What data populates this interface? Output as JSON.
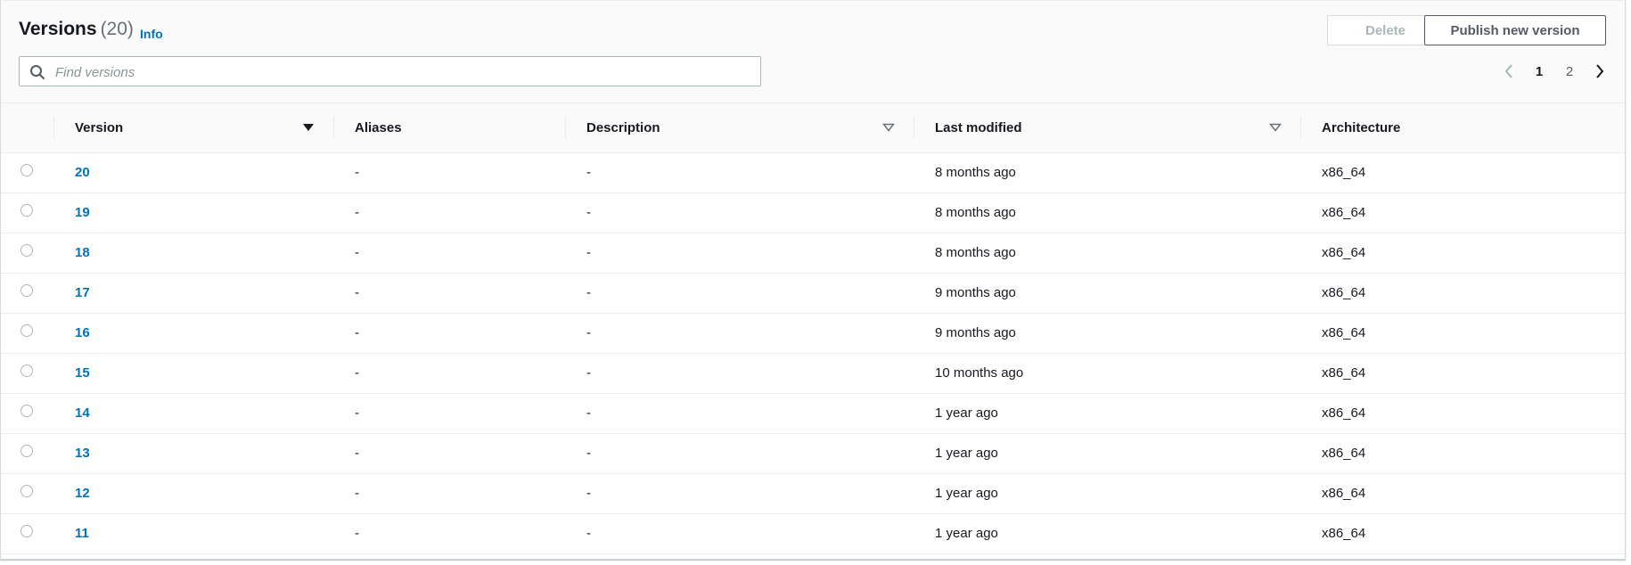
{
  "header": {
    "title": "Versions",
    "count": "(20)",
    "info_label": "Info",
    "delete_label": "Delete",
    "publish_label": "Publish new version"
  },
  "search": {
    "placeholder": "Find versions",
    "value": ""
  },
  "pagination": {
    "pages": [
      "1",
      "2"
    ],
    "current_page": "1"
  },
  "table": {
    "columns": [
      "Version",
      "Aliases",
      "Description",
      "Last modified",
      "Architecture"
    ],
    "rows": [
      {
        "version": "20",
        "aliases": "-",
        "description": "-",
        "last_modified": "8 months ago",
        "architecture": "x86_64"
      },
      {
        "version": "19",
        "aliases": "-",
        "description": "-",
        "last_modified": "8 months ago",
        "architecture": "x86_64"
      },
      {
        "version": "18",
        "aliases": "-",
        "description": "-",
        "last_modified": "8 months ago",
        "architecture": "x86_64"
      },
      {
        "version": "17",
        "aliases": "-",
        "description": "-",
        "last_modified": "9 months ago",
        "architecture": "x86_64"
      },
      {
        "version": "16",
        "aliases": "-",
        "description": "-",
        "last_modified": "9 months ago",
        "architecture": "x86_64"
      },
      {
        "version": "15",
        "aliases": "-",
        "description": "-",
        "last_modified": "10 months ago",
        "architecture": "x86_64"
      },
      {
        "version": "14",
        "aliases": "-",
        "description": "-",
        "last_modified": "1 year ago",
        "architecture": "x86_64"
      },
      {
        "version": "13",
        "aliases": "-",
        "description": "-",
        "last_modified": "1 year ago",
        "architecture": "x86_64"
      },
      {
        "version": "12",
        "aliases": "-",
        "description": "-",
        "last_modified": "1 year ago",
        "architecture": "x86_64"
      },
      {
        "version": "11",
        "aliases": "-",
        "description": "-",
        "last_modified": "1 year ago",
        "architecture": "x86_64"
      }
    ]
  },
  "icons": {
    "search": "search-icon",
    "prev": "chevron-left-icon",
    "next": "chevron-right-icon",
    "sort_active": "caret-down-filled-icon",
    "sort_inactive": "caret-down-outline-icon",
    "row_select": "radio-button"
  },
  "colors": {
    "link": "#0073bb",
    "text": "#16191f",
    "muted": "#687078",
    "disabled": "#aab7b8",
    "border": "#eaeded",
    "header_bg": "#fafafa"
  }
}
